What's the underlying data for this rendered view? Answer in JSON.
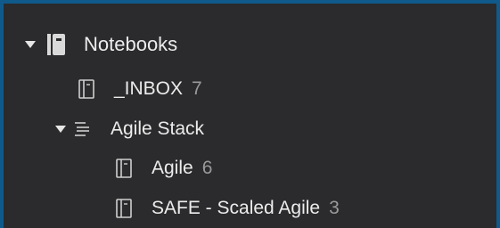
{
  "tree": {
    "root": {
      "label": "Notebooks",
      "icon": "notebooks-icon",
      "expanded": true
    },
    "items": [
      {
        "label": "_INBOX",
        "count": "7",
        "icon": "notebook-icon"
      },
      {
        "label": "Agile Stack",
        "icon": "stack-icon",
        "expanded": true
      },
      {
        "label": "Agile",
        "count": "6",
        "icon": "notebook-icon"
      },
      {
        "label": "SAFE - Scaled Agile",
        "count": "3",
        "icon": "notebook-icon"
      }
    ]
  }
}
